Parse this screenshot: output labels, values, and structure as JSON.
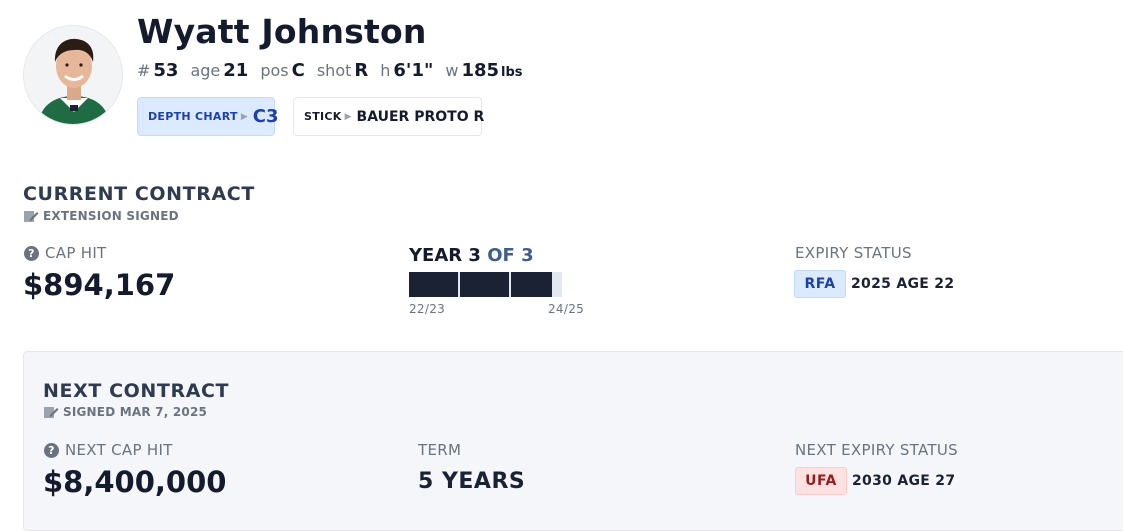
{
  "player": {
    "name": "Wyatt Johnston",
    "number_label": "#",
    "number": "53",
    "age_label": "age",
    "age": "21",
    "pos_label": "pos",
    "pos": "C",
    "shot_label": "shot",
    "shot": "R",
    "height_label": "h",
    "height": "6'1\"",
    "weight_label": "w",
    "weight": "185",
    "weight_unit": "lbs"
  },
  "chips": {
    "depth_label": "DEPTH CHART",
    "depth_value": "C3",
    "stick_label": "STICK",
    "stick_value": "BAUER PROTO R"
  },
  "current": {
    "title": "CURRENT CONTRACT",
    "subtitle": "EXTENSION SIGNED",
    "cap_hit_label": "CAP HIT",
    "cap_hit": "$894,167",
    "year_current": "YEAR 3",
    "year_of": "OF 3",
    "progress_filled_years": 3,
    "progress_total_years": 3,
    "start_season": "22/23",
    "end_season": "24/25",
    "expiry_label": "EXPIRY STATUS",
    "expiry_badge": "RFA",
    "expiry_text": "2025 AGE 22"
  },
  "next": {
    "title": "NEXT CONTRACT",
    "subtitle": "SIGNED MAR 7, 2025",
    "cap_hit_label": "NEXT CAP HIT",
    "cap_hit": "$8,400,000",
    "term_label": "TERM",
    "term": "5 YEARS",
    "expiry_label": "NEXT EXPIRY STATUS",
    "expiry_badge": "UFA",
    "expiry_text": "2030 AGE 27"
  },
  "colors": {
    "dark": "#1a2233",
    "rfa_bg": "#dbeafe",
    "rfa_text": "#1e40af",
    "ufa_bg": "#fee2e2",
    "ufa_text": "#991b1b",
    "jersey_green": "#1f6b43"
  },
  "icons": {
    "avatar": "player-headshot",
    "signed": "edit-document-icon",
    "info": "question-circle-icon",
    "chevron": "chevron-right-icon"
  }
}
